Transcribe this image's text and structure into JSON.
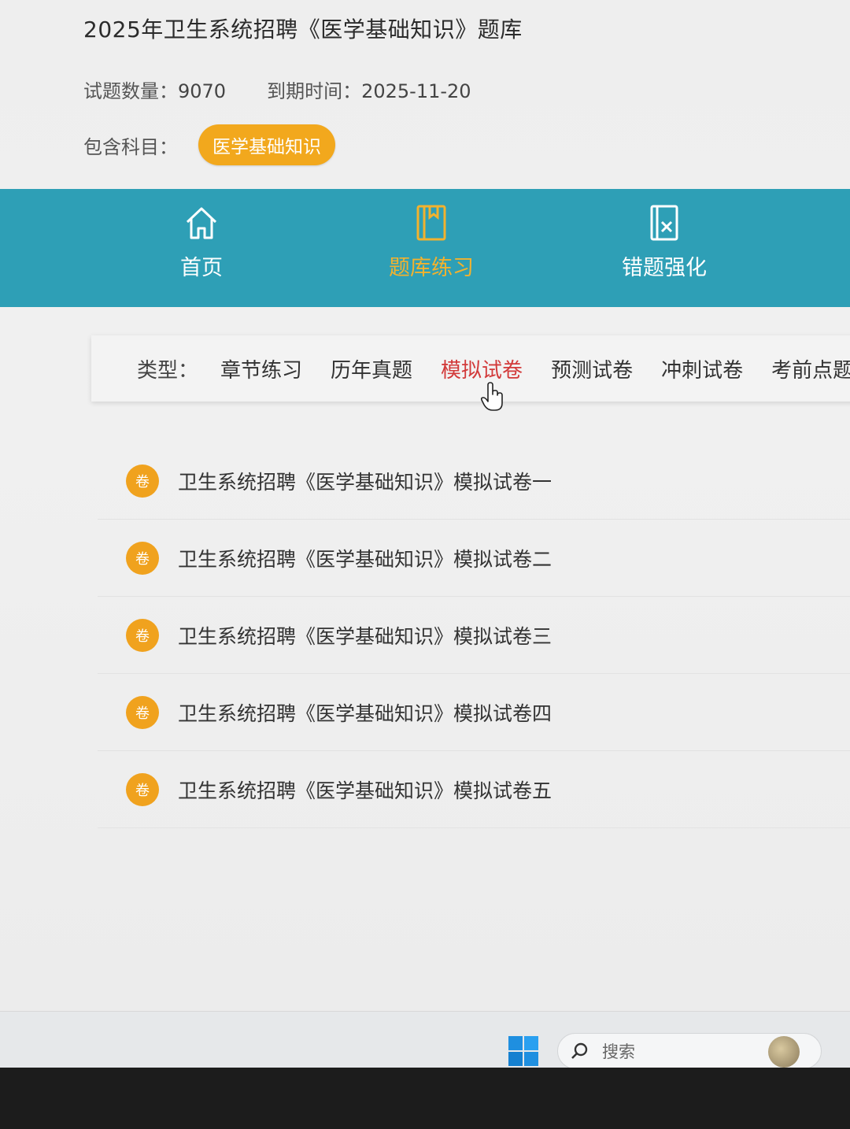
{
  "header": {
    "title": "2025年卫生系统招聘《医学基础知识》题库",
    "question_count_label": "试题数量：",
    "question_count": "9070",
    "expiry_label": "到期时间：",
    "expiry_date": "2025-11-20",
    "subjects_label": "包含科目：",
    "subject_tag": "医学基础知识"
  },
  "nav": {
    "items": [
      {
        "label": "首页",
        "icon": "home-icon"
      },
      {
        "label": "题库练习",
        "icon": "book-icon",
        "active": true
      },
      {
        "label": "错题强化",
        "icon": "wrong-doc-icon"
      }
    ]
  },
  "filter": {
    "label": "类型：",
    "options": [
      "章节练习",
      "历年真题",
      "模拟试卷",
      "预测试卷",
      "冲刺试卷",
      "考前点题"
    ],
    "active": "模拟试卷"
  },
  "papers": {
    "badge": "卷",
    "items": [
      "卫生系统招聘《医学基础知识》模拟试卷一",
      "卫生系统招聘《医学基础知识》模拟试卷二",
      "卫生系统招聘《医学基础知识》模拟试卷三",
      "卫生系统招聘《医学基础知识》模拟试卷四",
      "卫生系统招聘《医学基础知识》模拟试卷五"
    ]
  },
  "taskbar": {
    "search_placeholder": "搜索"
  },
  "colors": {
    "nav_bg": "#2e9fb6",
    "accent_orange": "#f2a81d",
    "active_filter": "#d23a3a"
  }
}
